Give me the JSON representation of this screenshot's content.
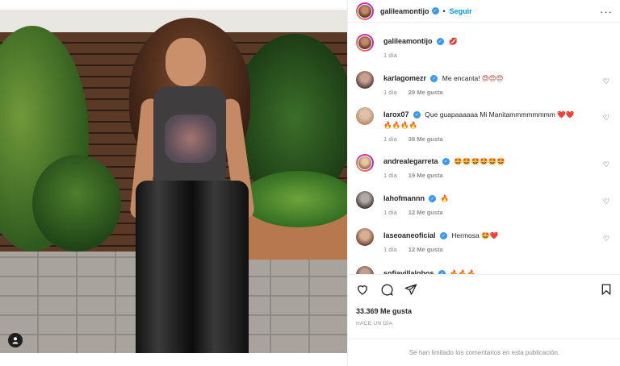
{
  "post": {
    "author": "galileamontijo",
    "follow_label": "Seguir",
    "dot": "•",
    "more_label": "···",
    "caption_emoji": "💋",
    "caption_age": "1 día"
  },
  "comments": [
    {
      "user": "karlagomezr",
      "verified": true,
      "text": "Me encanta!",
      "emoji": "😍😍😍",
      "age": "1 día",
      "likes": "29 Me gusta"
    },
    {
      "user": "larox07",
      "verified": true,
      "text": "Que guapaaaaaa Mi Manitammmmmmmm",
      "emoji": "❤️❤️",
      "emoji2": "🔥🔥🔥🔥",
      "age": "1 día",
      "likes": "38 Me gusta"
    },
    {
      "user": "andrealegarreta",
      "verified": true,
      "text": "",
      "emoji": "🤩🤩🤩🤩🤩🤩",
      "age": "1 día",
      "likes": "19 Me gusta"
    },
    {
      "user": "lahofmannn",
      "verified": true,
      "text": "",
      "emoji": "🔥",
      "age": "1 día",
      "likes": "12 Me gusta"
    },
    {
      "user": "laseoaneoficial",
      "verified": true,
      "text": "Hermosa",
      "emoji": "🤩❤️",
      "age": "1 día",
      "likes": "12 Me gusta"
    },
    {
      "user": "sofiavillalobos",
      "verified": true,
      "text": "",
      "emoji": "🔥🔥🔥",
      "age": "",
      "likes": ""
    }
  ],
  "engagement": {
    "likes": "33.369 Me gusta",
    "posted_ago": "HACE UN DÍA"
  },
  "footer": {
    "limited_text": "Se han limitado los comentarios en esta publicación."
  },
  "icons": {
    "verified": "✓",
    "heart": "♡",
    "user_tag": "person-icon"
  },
  "colors": {
    "accent": "#0095f6",
    "verified": "#3897f0",
    "muted": "#8e8e8e"
  }
}
